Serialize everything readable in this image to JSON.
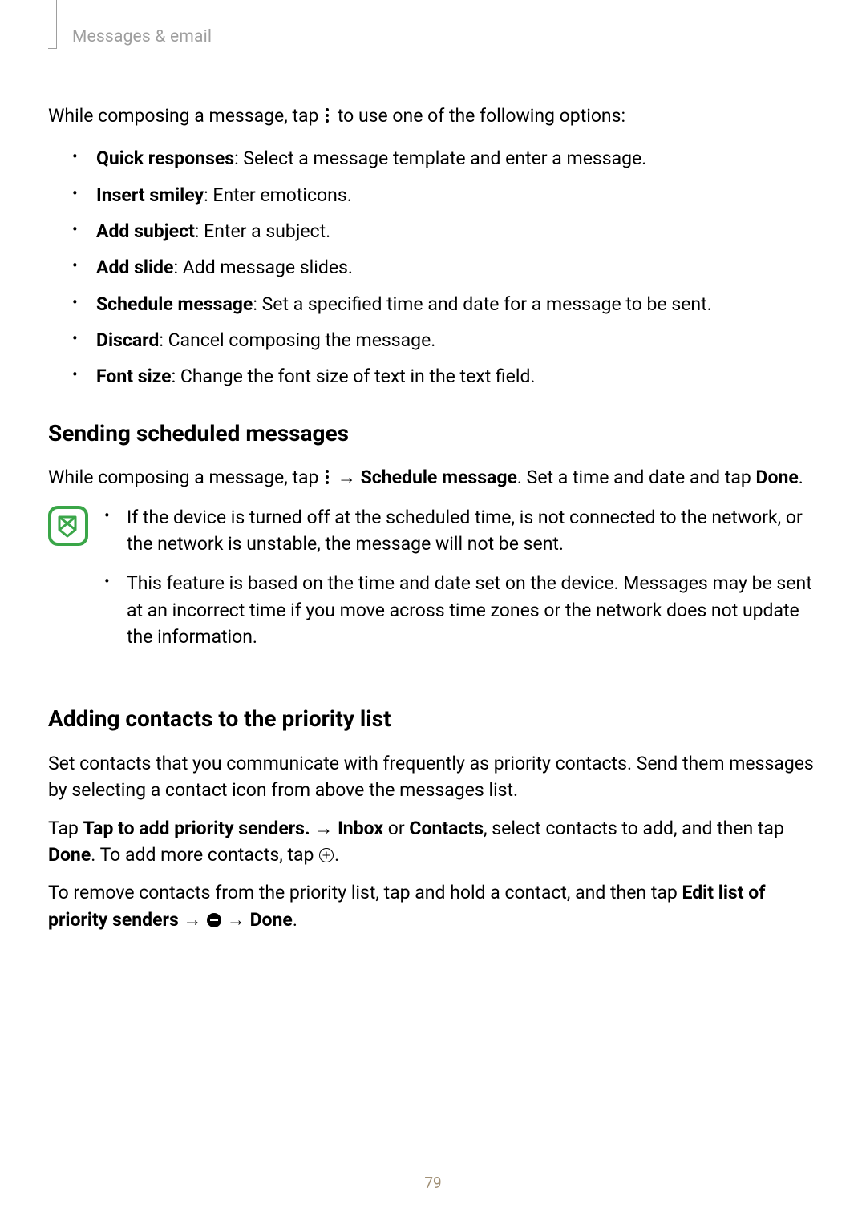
{
  "header": {
    "section": "Messages & email"
  },
  "intro": {
    "prefix": "While composing a message, tap ",
    "suffix": " to use one of the following options:"
  },
  "options": [
    {
      "label": "Quick responses",
      "desc": ": Select a message template and enter a message."
    },
    {
      "label": "Insert smiley",
      "desc": ": Enter emoticons."
    },
    {
      "label": "Add subject",
      "desc": ": Enter a subject."
    },
    {
      "label": "Add slide",
      "desc": ": Add message slides."
    },
    {
      "label": "Schedule message",
      "desc": ": Set a specified time and date for a message to be sent."
    },
    {
      "label": "Discard",
      "desc": ": Cancel composing the message."
    },
    {
      "label": "Font size",
      "desc": ": Change the font size of text in the text field."
    }
  ],
  "scheduled": {
    "heading": "Sending scheduled messages",
    "line_prefix": "While composing a message, tap ",
    "arrow": " → ",
    "schedule_label": "Schedule message",
    "line_mid": ". Set a time and date and tap ",
    "done_label": "Done",
    "line_end": ".",
    "notes": [
      "If the device is turned off at the scheduled time, is not connected to the network, or the network is unstable, the message will not be sent.",
      "This feature is based on the time and date set on the device. Messages may be sent at an incorrect time if you move across time zones or the network does not update the information."
    ]
  },
  "priority": {
    "heading": "Adding contacts to the priority list",
    "p1": "Set contacts that you communicate with frequently as priority contacts. Send them messages by selecting a contact icon from above the messages list.",
    "p2_prefix": "Tap ",
    "p2_tap": "Tap to add priority senders.",
    "p2_arrow1": " → ",
    "p2_inbox": "Inbox",
    "p2_or": " or ",
    "p2_contacts": "Contacts",
    "p2_mid": ", select contacts to add, and then tap ",
    "p2_done": "Done",
    "p2_mid2": ". To add more contacts, tap ",
    "p2_end": ".",
    "p3_prefix": "To remove contacts from the priority list, tap and hold a contact, and then tap ",
    "p3_edit": "Edit list of priority senders",
    "p3_arrow1": " → ",
    "p3_arrow2": " → ",
    "p3_done": "Done",
    "p3_end": "."
  },
  "page_number": "79"
}
